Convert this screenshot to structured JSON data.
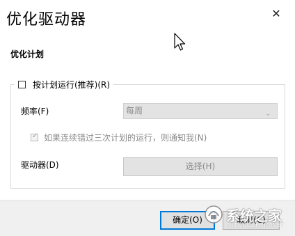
{
  "window": {
    "title": "优化驱动器"
  },
  "schedule": {
    "section_title": "优化计划",
    "run_on_schedule_label": "按计划运行(推荐)(R)",
    "frequency_label": "频率(F)",
    "frequency_value": "每周",
    "notify_label": "如果连续错过三次计划的运行，则通知我(N)",
    "drives_label": "驱动器(D)",
    "choose_button": "选择(H)"
  },
  "footer": {
    "ok_label": "确定(O)",
    "cancel_label": "取消(C)"
  },
  "watermark": {
    "text": "系统之家",
    "subtext": "XITONGZHIJIA.NET"
  },
  "colors": {
    "focus_border": "#0078d7",
    "footer_bg": "#f0f0f0",
    "disabled_bg": "#e3e3e3",
    "disabled_text": "#8a8a8a"
  }
}
